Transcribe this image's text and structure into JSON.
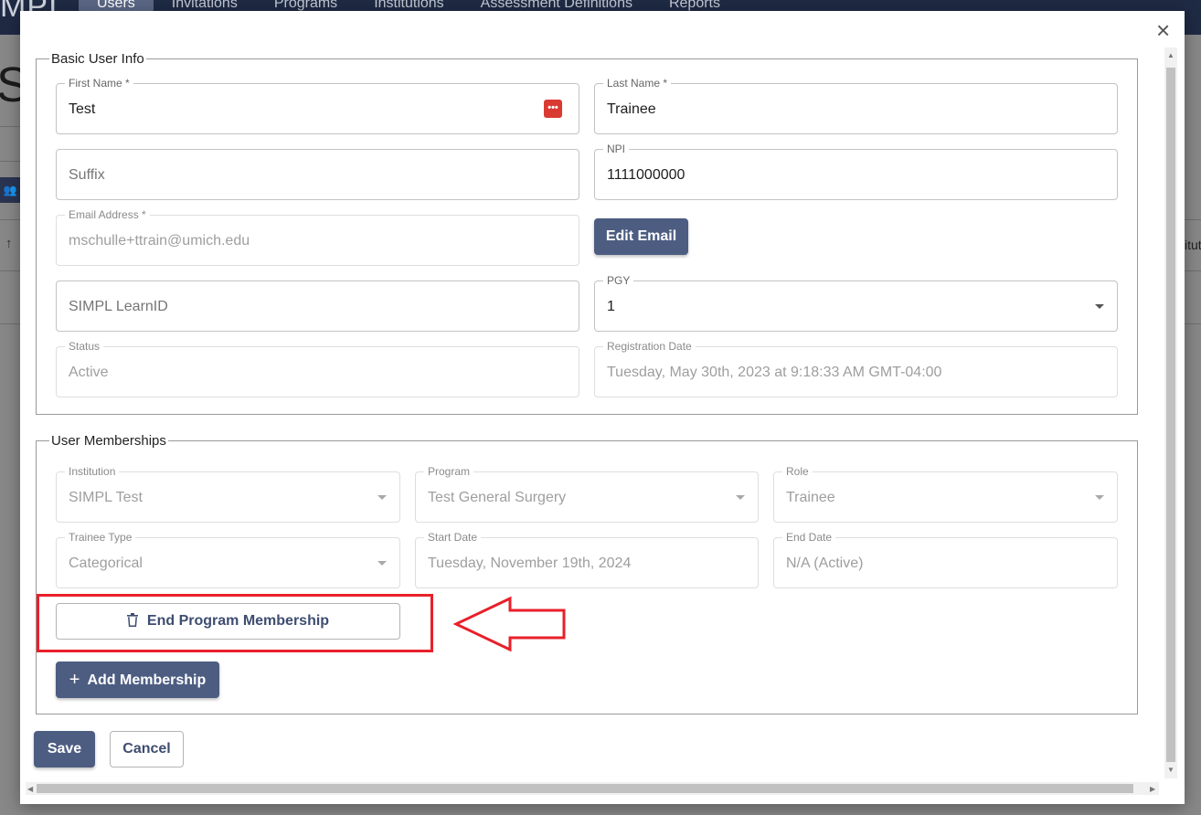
{
  "background": {
    "logo_fragment": "MPI",
    "nav_tabs": [
      "Users",
      "Invitations",
      "Programs",
      "Institutions",
      "Assessment Definitions",
      "Reports"
    ],
    "big_text_fragment": "S",
    "right_edge_fragment": "itut"
  },
  "modal": {
    "basic_info": {
      "legend": "Basic User Info",
      "first_name": {
        "label": "First Name *",
        "value": "Test"
      },
      "last_name": {
        "label": "Last Name *",
        "value": "Trainee"
      },
      "suffix": {
        "placeholder": "Suffix"
      },
      "npi": {
        "label": "NPI",
        "value": "1111000000"
      },
      "email": {
        "label": "Email Address *",
        "value": "mschulle+ttrain@umich.edu"
      },
      "edit_email_label": "Edit Email",
      "learn_id": {
        "placeholder": "SIMPL LearnID"
      },
      "pgy": {
        "label": "PGY",
        "value": "1"
      },
      "status": {
        "label": "Status",
        "value": "Active"
      },
      "registration_date": {
        "label": "Registration Date",
        "value": "Tuesday, May 30th, 2023 at 9:18:33 AM GMT-04:00"
      }
    },
    "memberships": {
      "legend": "User Memberships",
      "institution": {
        "label": "Institution",
        "value": "SIMPL Test"
      },
      "program": {
        "label": "Program",
        "value": "Test General Surgery"
      },
      "role": {
        "label": "Role",
        "value": "Trainee"
      },
      "trainee_type": {
        "label": "Trainee Type",
        "value": "Categorical"
      },
      "start_date": {
        "label": "Start Date",
        "value": "Tuesday, November 19th, 2024"
      },
      "end_date": {
        "label": "End Date",
        "value": "N/A (Active)"
      },
      "end_membership_label": "End Program Membership",
      "add_membership_label": "Add Membership"
    },
    "save_label": "Save",
    "cancel_label": "Cancel"
  },
  "colors": {
    "primary": "#4d5d82",
    "annotation_red": "#e8202a",
    "password_icon": "#d93a32"
  }
}
